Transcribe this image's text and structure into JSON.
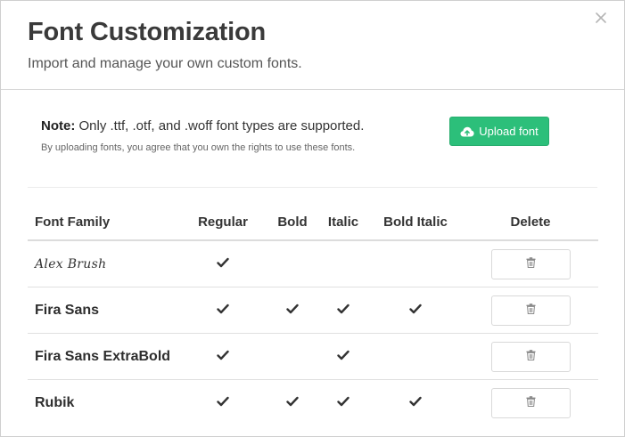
{
  "modal": {
    "title": "Font Customization",
    "subtitle": "Import and manage your own custom fonts."
  },
  "note": {
    "label": "Note:",
    "text": " Only .ttf, .otf, and .woff font types are supported.",
    "subtext": "By uploading fonts, you agree that you own the rights to use these fonts."
  },
  "upload": {
    "label": "Upload font",
    "icon": "cloud-upload-icon",
    "color": "#2cbf7a"
  },
  "table": {
    "headers": {
      "family": "Font Family",
      "regular": "Regular",
      "bold": "Bold",
      "italic": "Italic",
      "bold_italic": "Bold Italic",
      "delete": "Delete"
    },
    "rows": [
      {
        "family": "Alex Brush",
        "regular": true,
        "bold": false,
        "italic": false,
        "bold_italic": false
      },
      {
        "family": "Fira Sans",
        "regular": true,
        "bold": true,
        "italic": true,
        "bold_italic": true
      },
      {
        "family": "Fira Sans ExtraBold",
        "regular": true,
        "bold": false,
        "italic": true,
        "bold_italic": false
      },
      {
        "family": "Rubik",
        "regular": true,
        "bold": true,
        "italic": true,
        "bold_italic": true
      }
    ]
  },
  "icons": {
    "close": "close-icon",
    "check": "check-icon",
    "delete": "trash-icon"
  }
}
